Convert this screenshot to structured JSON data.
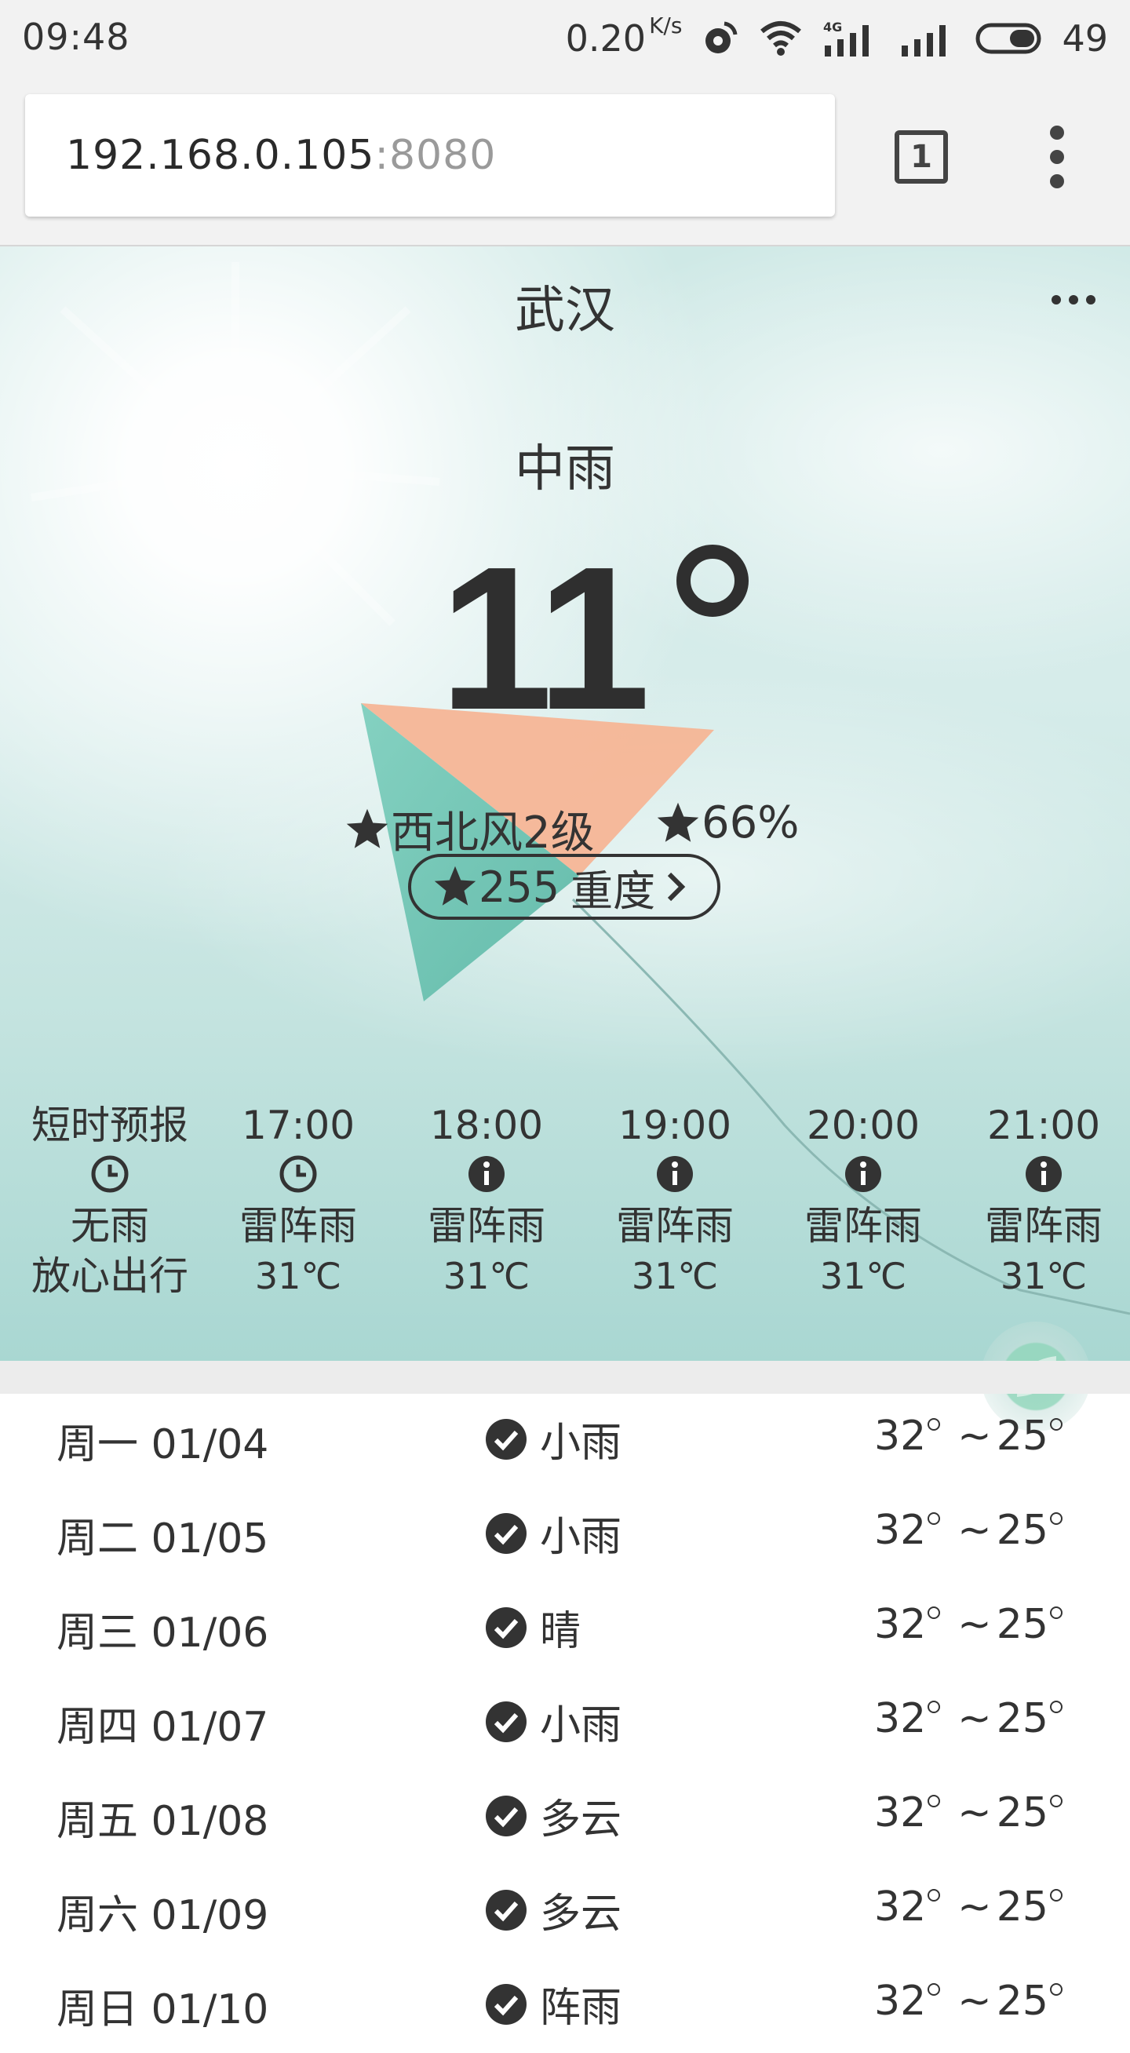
{
  "status_bar": {
    "time": "09:48",
    "net_speed": "0.20",
    "net_unit": "K/s",
    "battery": "49",
    "icons": [
      "data-sync-icon",
      "wifi-icon",
      "signal-4g-icon",
      "signal-icon",
      "battery-icon"
    ]
  },
  "browser": {
    "url_host": "192.168.0.105",
    "url_port": ":8080",
    "tab_count": "1"
  },
  "weather": {
    "city": "武汉",
    "condition": "中雨",
    "temperature": "11",
    "wind": "西北风2级",
    "humidity": "66%",
    "aqi_value": "255",
    "aqi_level": "重度"
  },
  "hourly": {
    "header": {
      "title": "短时预报",
      "desc": "无雨",
      "sub": "放心出行"
    },
    "items": [
      {
        "time": "17:00",
        "desc": "雷阵雨",
        "temp": "31℃",
        "icon": "clock-icon"
      },
      {
        "time": "18:00",
        "desc": "雷阵雨",
        "temp": "31℃",
        "icon": "info-icon"
      },
      {
        "time": "19:00",
        "desc": "雷阵雨",
        "temp": "31℃",
        "icon": "info-icon"
      },
      {
        "time": "20:00",
        "desc": "雷阵雨",
        "temp": "31℃",
        "icon": "info-icon"
      },
      {
        "time": "21:00",
        "desc": "雷阵雨",
        "temp": "31℃",
        "icon": "info-icon"
      }
    ]
  },
  "daily": [
    {
      "date": "周一 01/04",
      "condition": "小雨",
      "high": "32",
      "low": "25"
    },
    {
      "date": "周二 01/05",
      "condition": "小雨",
      "high": "32",
      "low": "25"
    },
    {
      "date": "周三 01/06",
      "condition": "晴",
      "high": "32",
      "low": "25"
    },
    {
      "date": "周四 01/07",
      "condition": "小雨",
      "high": "32",
      "low": "25"
    },
    {
      "date": "周五 01/08",
      "condition": "多云",
      "high": "32",
      "low": "25"
    },
    {
      "date": "周六 01/09",
      "condition": "多云",
      "high": "32",
      "low": "25"
    },
    {
      "date": "周日 01/10",
      "condition": "阵雨",
      "high": "32",
      "low": "25"
    }
  ],
  "colors": {
    "kite_orange": "#f6b596",
    "kite_teal": "#6cc4b4",
    "sky": "#cfe9e6"
  }
}
